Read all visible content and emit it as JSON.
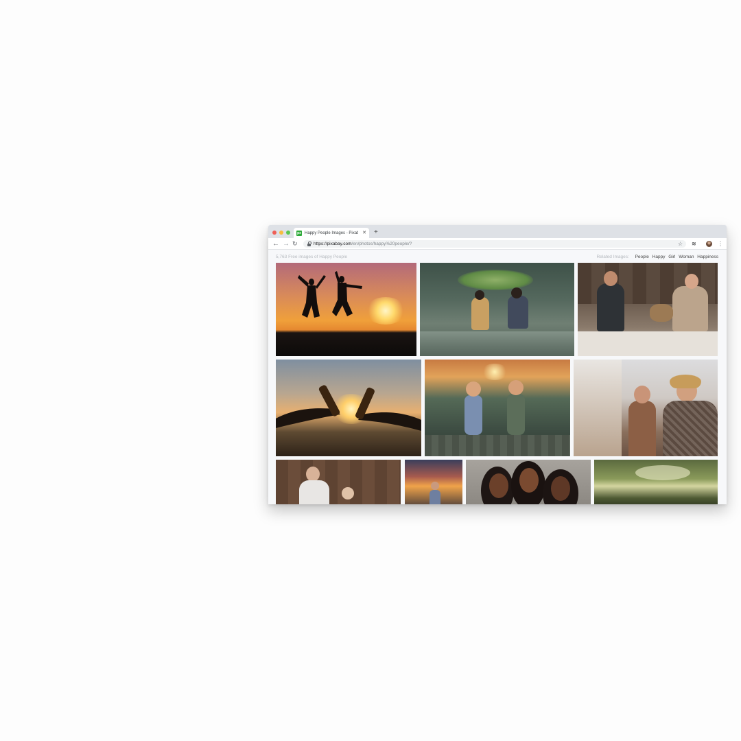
{
  "browser": {
    "tab": {
      "favicon_text": "px",
      "title": "Happy People Images - Pixabay",
      "close_glyph": "✕"
    },
    "new_tab_glyph": "+",
    "nav": {
      "back": "←",
      "forward": "→",
      "reload": "↻"
    },
    "url": {
      "host": "https://pixabay.com",
      "path": "/en/photos/happy%20people/?"
    },
    "star_glyph": "☆",
    "extension_glyph": "≋",
    "menu_glyph": "⋮"
  },
  "page": {
    "result_count": "5,763 Free images of Happy People",
    "related_label": "Related Images:",
    "related_tags": [
      "People",
      "Happy",
      "Girl",
      "Woman",
      "Happiness"
    ]
  },
  "photos": [
    {
      "name": "photo-jumping-silhouettes-sunset"
    },
    {
      "name": "photo-children-leaf-umbrella-rain"
    },
    {
      "name": "photo-couple-with-dog-on-couch"
    },
    {
      "name": "photo-bottles-toast-sunset"
    },
    {
      "name": "photo-toddlers-holding-hands"
    },
    {
      "name": "photo-women-laughing-outdoors"
    },
    {
      "name": "photo-mother-and-baby-wood-wall"
    },
    {
      "name": "photo-child-at-sunset"
    },
    {
      "name": "photo-three-smiling-women"
    },
    {
      "name": "photo-landscape-clouds"
    }
  ],
  "colors": {
    "tabbar": "#dee1e6",
    "page_background": "#f7f8fa",
    "favicon": "#2eaa3a"
  }
}
